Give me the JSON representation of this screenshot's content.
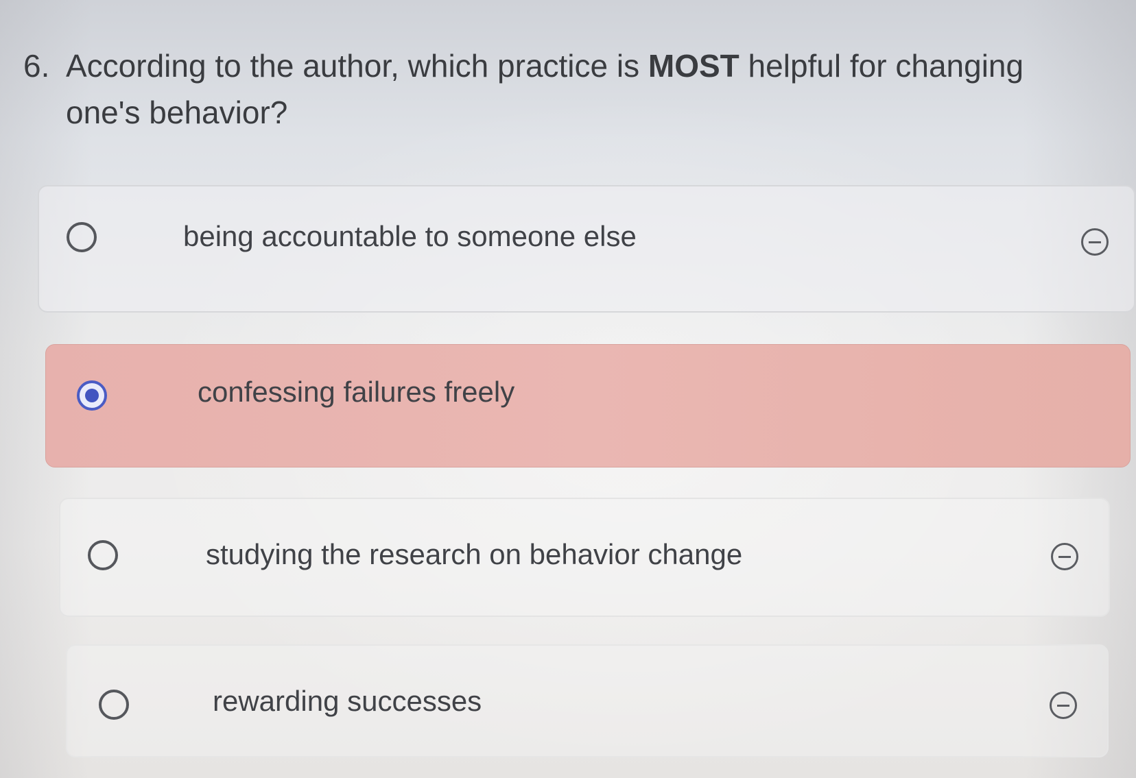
{
  "question": {
    "number": "6.",
    "text_before": "According to the author, which practice is ",
    "emphasis": "MOST",
    "text_after": " helpful for changing one's behavior?"
  },
  "options": [
    {
      "label": "being accountable to someone else",
      "selected": false,
      "eliminate_icon": "minus-circle-icon"
    },
    {
      "label": "confessing failures freely",
      "selected": true,
      "eliminate_icon": null
    },
    {
      "label": "studying the research on behavior change",
      "selected": false,
      "eliminate_icon": "minus-circle-icon"
    },
    {
      "label": "rewarding successes",
      "selected": false,
      "eliminate_icon": "minus-circle-icon"
    }
  ],
  "colors": {
    "selected_highlight": "#e8b4af",
    "selected_radio": "#4255c0"
  }
}
